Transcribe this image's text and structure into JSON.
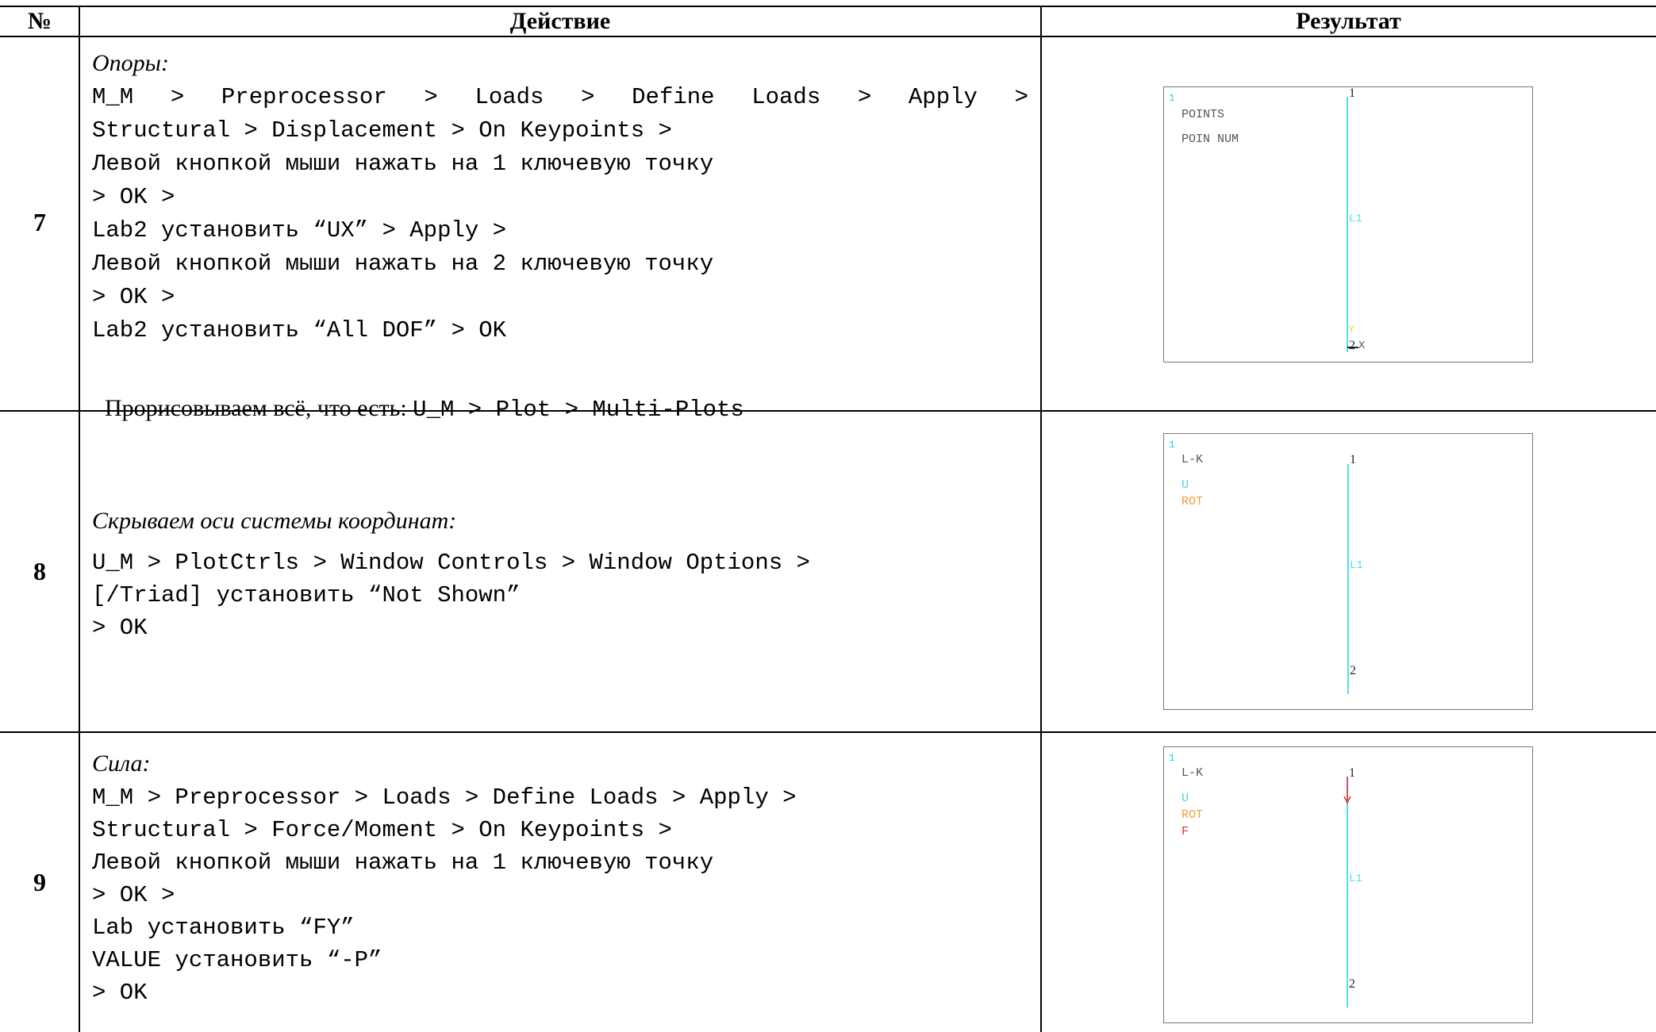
{
  "header": {
    "num": "№",
    "action": "Действие",
    "result": "Результат"
  },
  "rows": [
    {
      "num": "7",
      "title": "Опоры:",
      "lines": [
        [
          "M_M",
          ">",
          "Preprocessor",
          ">",
          "Loads",
          ">",
          "Define",
          "Loads",
          ">",
          "Apply",
          ">"
        ],
        "Structural > Displacement > On Keypoints >",
        "Левой кнопкой мыши нажать на 1 ключевую точку",
        "> OK >",
        "Lab2 установить “UX” > Apply >",
        "Левой кнопкой мыши нажать на 2 ключевую точку",
        "> OK >",
        "Lab2 установить “All DOF” > OK"
      ],
      "footer_text": "Прорисовываем всё, что есть: ",
      "footer_code": "U_M > Plot > Multi-Plots",
      "plot": {
        "corner": "1",
        "labels": [
          "POINTS",
          "POIN NUM"
        ],
        "kp_top": "1",
        "line_label": "L1",
        "kp_bottom": "2",
        "axis_x": "X",
        "axis_y": "Y"
      }
    },
    {
      "num": "8",
      "title": "Скрываем оси системы координат:",
      "lines": [
        "U_M > PlotCtrls > Window Controls > Window Options >",
        "[/Triad] установить “Not Shown”",
        "> OK"
      ],
      "plot": {
        "corner": "1",
        "labels": [
          "L-K",
          "U",
          "ROT"
        ],
        "kp_top": "1",
        "line_label": "L1",
        "kp_bottom": "2"
      }
    },
    {
      "num": "9",
      "title": "Сила:",
      "lines": [
        "M_M > Preprocessor > Loads > Define Loads > Apply >",
        "Structural > Force/Moment > On Keypoints >",
        "Левой кнопкой мыши нажать на 1 ключевую точку",
        "> OK >",
        "Lab установить “FY”",
        "VALUE установить “-P”",
        "> OK"
      ],
      "plot": {
        "corner": "1",
        "labels": [
          "L-K",
          "U",
          "ROT",
          "F"
        ],
        "kp_top": "1",
        "line_label": "L1",
        "kp_bottom": "2"
      }
    }
  ],
  "colors": {
    "u": "#3fd8e6",
    "rot": "#f0a030",
    "f": "#e03030",
    "line": "#4fe0ea",
    "axis_y": "#c8e840"
  }
}
